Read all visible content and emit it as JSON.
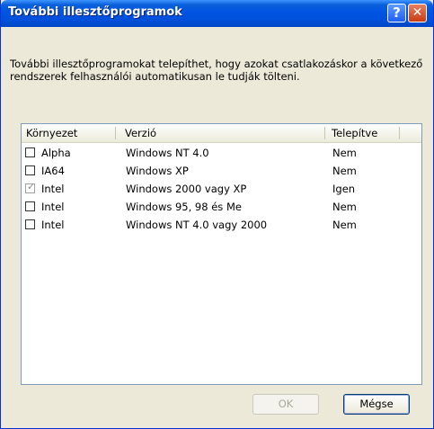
{
  "window": {
    "title": "További illesztőprogramok",
    "help_label": "?",
    "close_label": "✕"
  },
  "description": "További illesztőprogramokat telepíthet, hogy azokat csatlakozáskor a következő rendszerek felhasználói automatikusan le tudják tölteni.",
  "list": {
    "columns": [
      "Környezet",
      "Verzió",
      "Telepítve"
    ],
    "rows": [
      {
        "environment": "Alpha",
        "version": "Windows NT 4.0",
        "installed": "Nem",
        "checked": false
      },
      {
        "environment": "IA64",
        "version": "Windows XP",
        "installed": "Nem",
        "checked": false
      },
      {
        "environment": "Intel",
        "version": "Windows 2000 vagy XP",
        "installed": "Igen",
        "checked": true
      },
      {
        "environment": "Intel",
        "version": "Windows 95, 98 és Me",
        "installed": "Nem",
        "checked": false
      },
      {
        "environment": "Intel",
        "version": "Windows NT 4.0 vagy 2000",
        "installed": "Nem",
        "checked": false
      }
    ]
  },
  "buttons": {
    "ok": "OK",
    "cancel": "Mégse"
  }
}
